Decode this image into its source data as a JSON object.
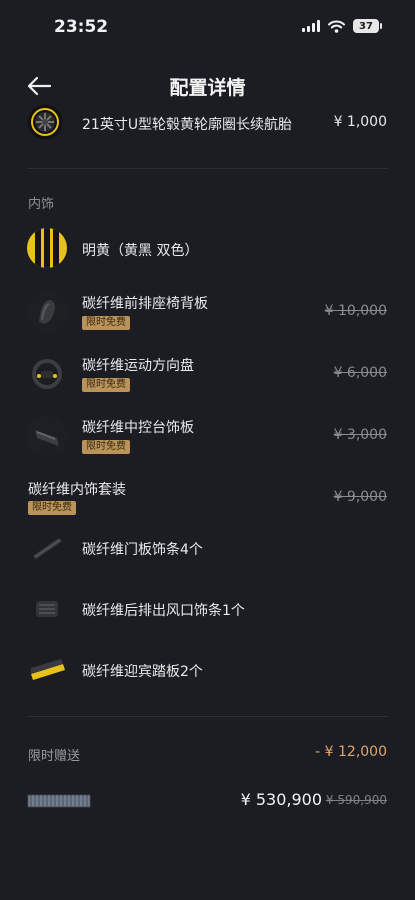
{
  "status_bar": {
    "time": "23:52",
    "battery": "37"
  },
  "header": {
    "title": "配置详情"
  },
  "wheel": {
    "name": "21英寸U型轮毂黄轮廓圈长续航胎",
    "price": "¥ 1,000"
  },
  "interior": {
    "section_label": "内饰",
    "color_option": {
      "name": "明黄（黄黑 双色）"
    },
    "items": [
      {
        "name": "碳纤维前排座椅背板",
        "badge": "限时免费",
        "original_price": "¥ 10,000"
      },
      {
        "name": "碳纤维运动方向盘",
        "badge": "限时免费",
        "original_price": "¥ 6,000"
      },
      {
        "name": "碳纤维中控台饰板",
        "badge": "限时免费",
        "original_price": "¥ 3,000"
      }
    ],
    "package": {
      "name": "碳纤维内饰套装",
      "badge": "限时免费",
      "original_price": "¥ 9,000",
      "items": [
        {
          "name": "碳纤维门板饰条4个"
        },
        {
          "name": "碳纤维后排出风口饰条1个"
        },
        {
          "name": "碳纤维迎宾踏板2个"
        }
      ]
    }
  },
  "gift": {
    "label": "限时赠送",
    "amount": "- ¥ 12,000"
  },
  "total": {
    "price": "¥ 530,900",
    "original_price": "¥ 590,900"
  },
  "colors": {
    "background": "#1c1d22",
    "badge": "#b9935a",
    "gift": "#e2a46a",
    "accent_yellow": "#e8c21c"
  }
}
